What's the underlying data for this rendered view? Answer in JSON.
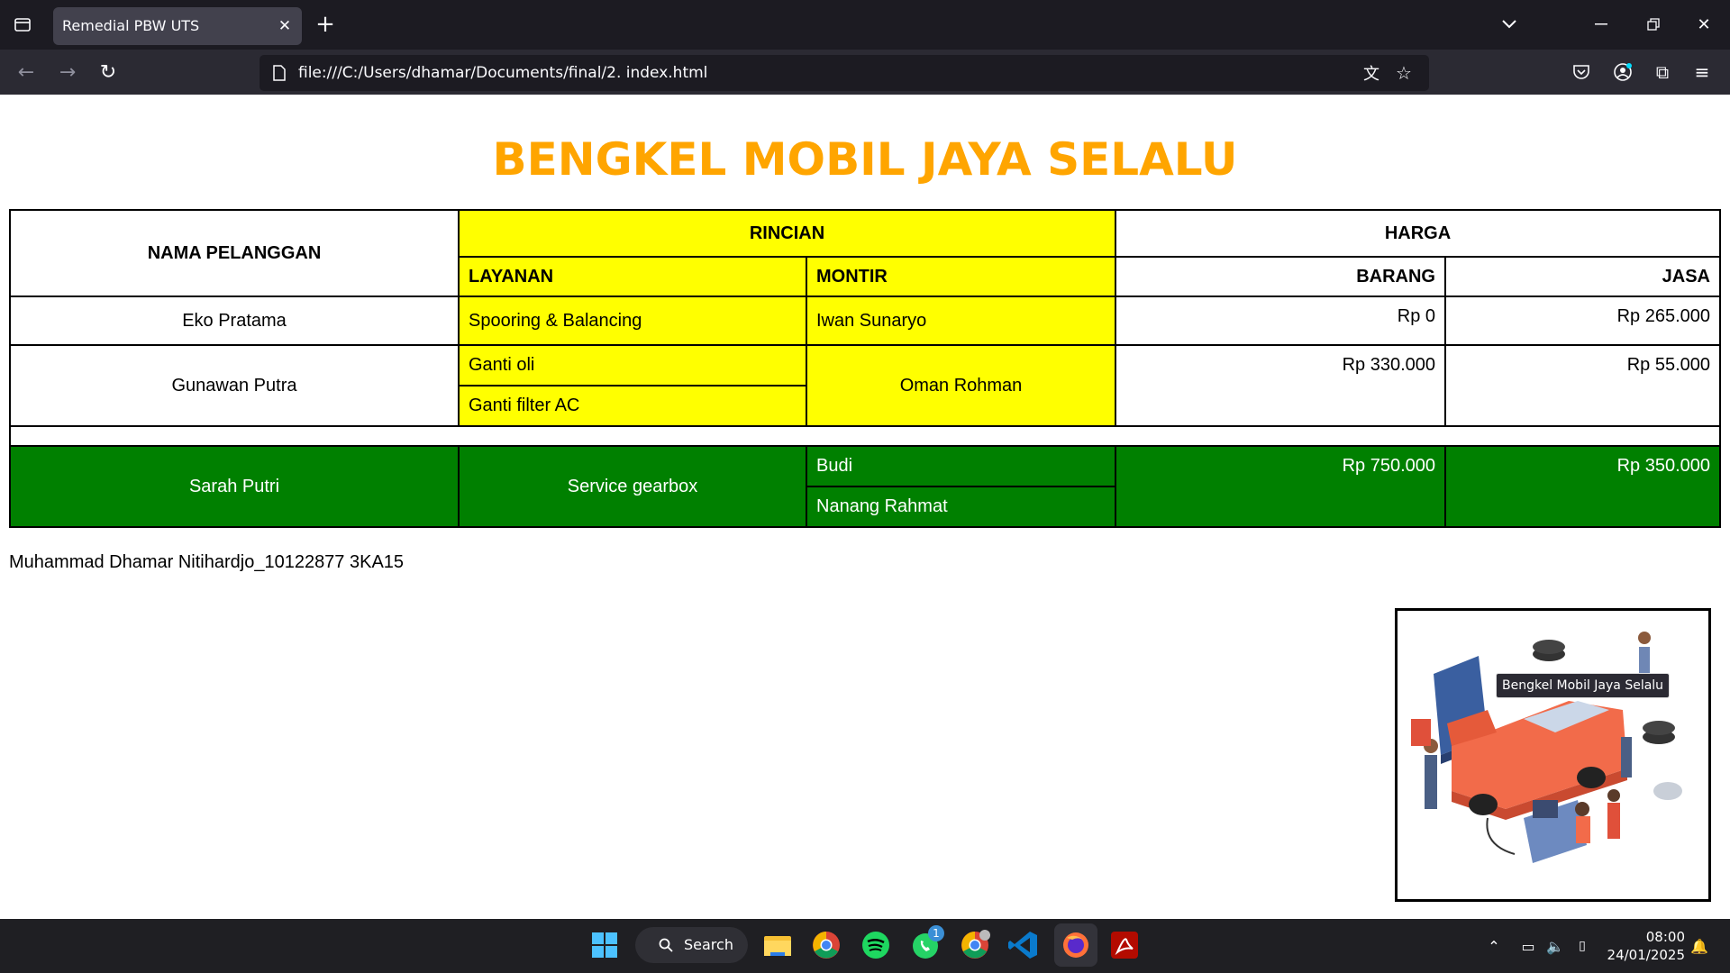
{
  "browser": {
    "tab_title": "Remedial PBW UTS",
    "url": "file:///C:/Users/dhamar/Documents/final/2. index.html",
    "tooltip": "Bengkel Mobil Jaya Selalu"
  },
  "page": {
    "title": "BENGKEL MOBIL JAYA SELALU",
    "headers": {
      "nama": "NAMA PELANGGAN",
      "rincian": "RINCIAN",
      "harga": "HARGA",
      "layanan": "LAYANAN",
      "montir": "MONTIR",
      "barang": "BARANG",
      "jasa": "JASA"
    },
    "rows": [
      {
        "nama": "Eko Pratama",
        "layanan": [
          "Spooring & Balancing"
        ],
        "montir": [
          "Iwan Sunaryo"
        ],
        "barang": "Rp 0",
        "jasa": "Rp 265.000"
      },
      {
        "nama": "Gunawan Putra",
        "layanan": [
          "Ganti oli",
          "Ganti filter AC"
        ],
        "montir": [
          "Oman Rohman"
        ],
        "barang": "Rp 330.000",
        "jasa": "Rp 55.000"
      },
      {
        "nama": "Sarah Putri",
        "layanan": [
          "Service gearbox"
        ],
        "montir": [
          "Budi",
          "Nanang Rahmat"
        ],
        "barang": "Rp 750.000",
        "jasa": "Rp 350.000"
      }
    ],
    "author": "Muhammad Dhamar Nitihardjo_10122877 3KA15"
  },
  "taskbar": {
    "search_label": "Search",
    "time": "08:00",
    "date": "24/01/2025",
    "whatsapp_badge": "1"
  },
  "colors": {
    "title": "#ffa500",
    "yellow_rows": "#ffff00",
    "green_row": "#008000"
  }
}
